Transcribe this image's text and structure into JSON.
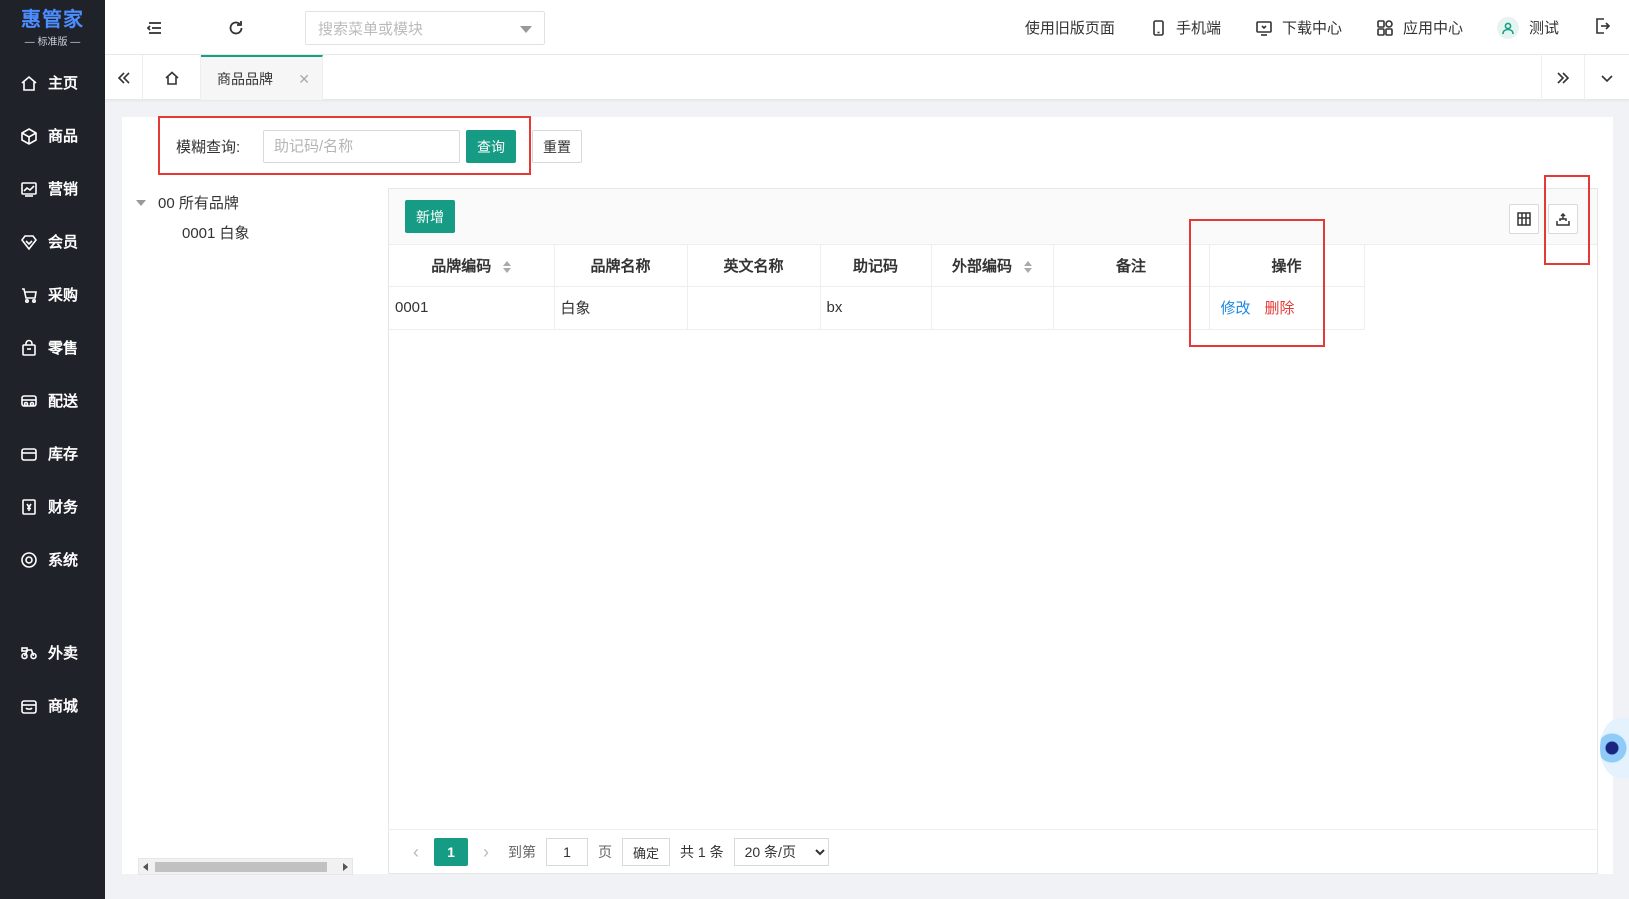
{
  "logo": {
    "main": "惠管家",
    "sub": "— 标准版 —"
  },
  "sidebar": {
    "items": [
      {
        "label": "主页",
        "icon": "home-icon"
      },
      {
        "label": "商品",
        "icon": "cube-icon"
      },
      {
        "label": "营销",
        "icon": "chart-icon"
      },
      {
        "label": "会员",
        "icon": "diamond-icon"
      },
      {
        "label": "采购",
        "icon": "cart-icon"
      },
      {
        "label": "零售",
        "icon": "bag-icon"
      },
      {
        "label": "配送",
        "icon": "truck-icon"
      },
      {
        "label": "库存",
        "icon": "box-icon"
      },
      {
        "label": "财务",
        "icon": "yen-icon"
      },
      {
        "label": "系统",
        "icon": "settings-icon"
      },
      {
        "label": "外卖",
        "icon": "bike-icon"
      },
      {
        "label": "商城",
        "icon": "store-icon"
      }
    ]
  },
  "topbar": {
    "search_placeholder": "搜索菜单或模块",
    "old_version": "使用旧版页面",
    "mobile": "手机端",
    "download": "下载中心",
    "apps": "应用中心",
    "user": "测试"
  },
  "tabs": {
    "active": "商品品牌"
  },
  "filter": {
    "label": "模糊查询:",
    "placeholder": "助记码/名称",
    "query_button": "查询",
    "reset_button": "重置"
  },
  "tree": {
    "root": "00 所有品牌",
    "children": [
      "0001 白象"
    ]
  },
  "toolbar": {
    "add_button": "新增"
  },
  "table": {
    "headers": [
      "品牌编码",
      "品牌名称",
      "英文名称",
      "助记码",
      "外部编码",
      "备注",
      "操作"
    ],
    "rows": [
      {
        "code": "0001",
        "name": "白象",
        "english": "",
        "mnemonic": "bx",
        "external": "",
        "remark": "",
        "edit": "修改",
        "delete": "删除"
      }
    ]
  },
  "pagination": {
    "current": "1",
    "goto_label": "到第",
    "page_input": "1",
    "page_unit": "页",
    "confirm": "确定",
    "total": "共 1 条",
    "page_size": "20 条/页"
  },
  "colors": {
    "accent": "#169c85",
    "sidebar": "#20222a",
    "highlight": "#e53935",
    "link": "#1e88e5"
  }
}
